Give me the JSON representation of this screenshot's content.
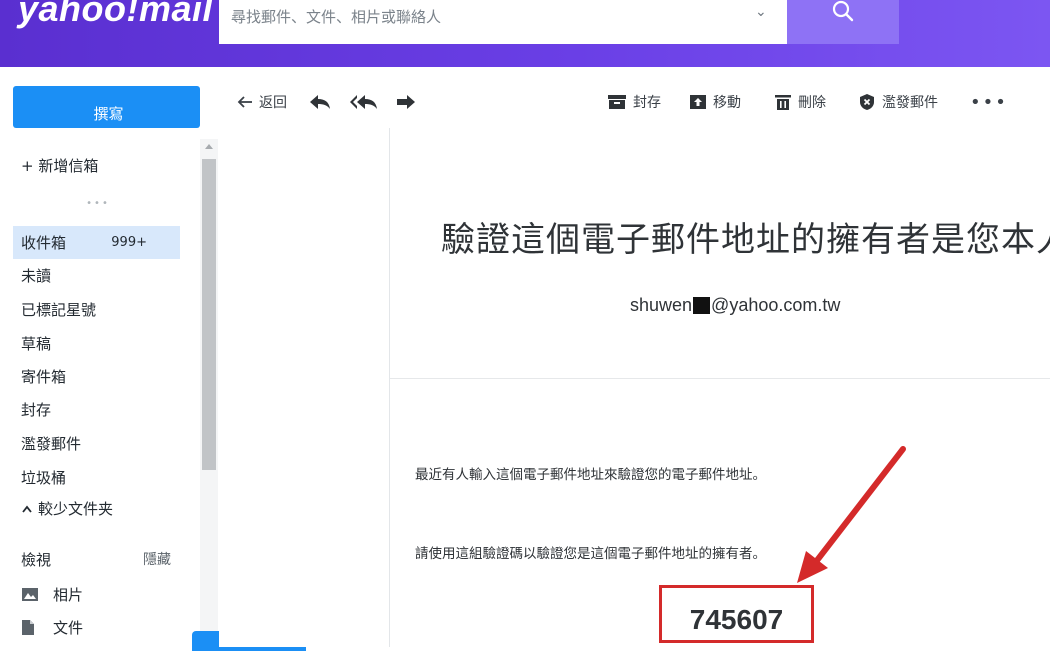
{
  "header": {
    "logo_text": "yahoo!mail",
    "search_placeholder": "尋找郵件、文件、相片或聯絡人"
  },
  "compose": {
    "label": "撰寫"
  },
  "toolbar": {
    "back_label": "返回",
    "archive_label": "封存",
    "move_label": "移動",
    "delete_label": "刪除",
    "spam_label": "濫發郵件",
    "more_label": "•••"
  },
  "sidebar": {
    "new_folder_label": "+ 新增信箱",
    "divider_label": "•••",
    "folders": [
      {
        "label": "收件箱",
        "badge": "999+"
      },
      {
        "label": "未讀"
      },
      {
        "label": "已標記星號"
      },
      {
        "label": "草稿"
      },
      {
        "label": "寄件箱"
      },
      {
        "label": "封存"
      },
      {
        "label": "濫發郵件"
      },
      {
        "label": "垃圾桶"
      }
    ],
    "less_folders_label": "較少文件夹",
    "view_label": "檢視",
    "hide_label": "隱藏",
    "photos_label": "相片",
    "docs_label": "文件"
  },
  "email": {
    "title": "驗證這個電子郵件地址的擁有者是您本人",
    "address_prefix": "shuwen",
    "address_suffix": "@yahoo.com.tw",
    "paragraph_1": "最近有人輸入這個電子郵件地址來驗證您的電子郵件地址。",
    "paragraph_2": "請使用這組驗證碼以驗證您是這個電子郵件地址的擁有者。",
    "code": "745607"
  },
  "colors": {
    "header_purple": "#6a3fe6",
    "search_button": "#8e72f5",
    "compose_blue": "#1b8ff5",
    "active_folder_bg": "#d8e8fb",
    "annotation_red": "#d42a2a"
  }
}
